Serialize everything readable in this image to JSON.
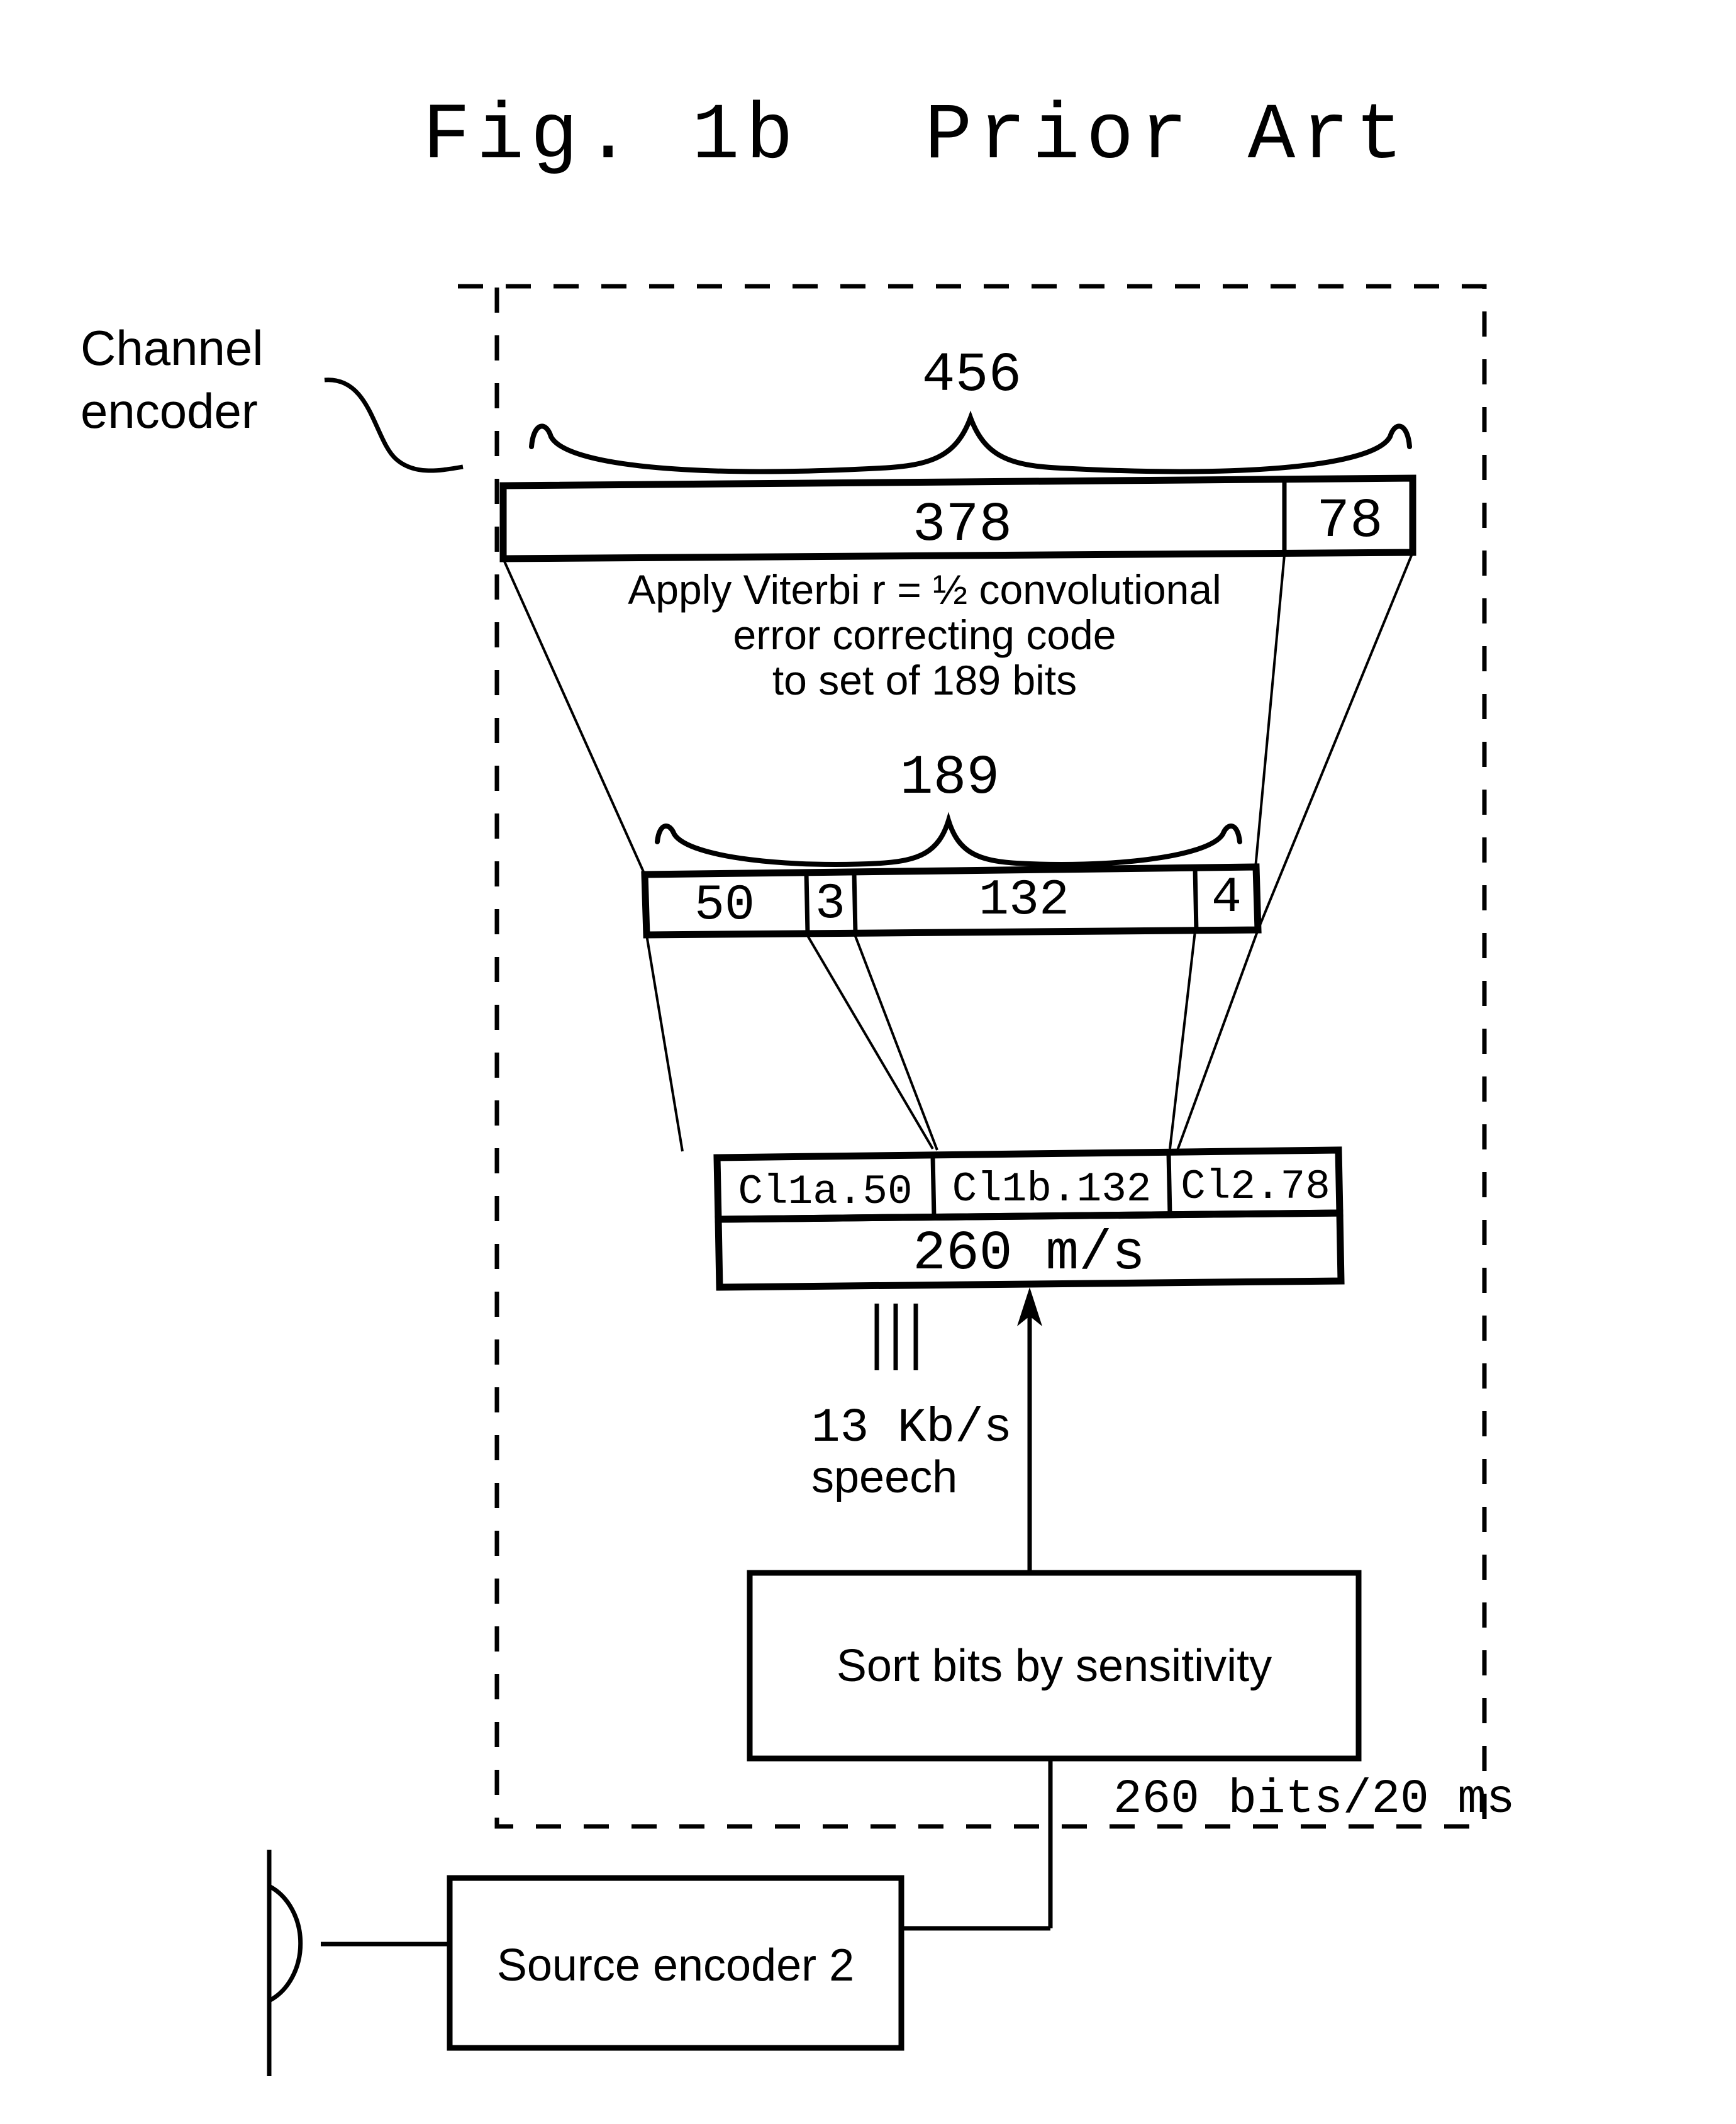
{
  "figure": {
    "title_label": "Fig. 1b",
    "title_note": "Prior Art",
    "channel_encoder_label_line1": "Channel",
    "channel_encoder_label_line2": "encoder"
  },
  "top_block": {
    "brace_label": "456",
    "segments": [
      {
        "label": "378"
      },
      {
        "label": "78"
      }
    ]
  },
  "viterbi_block": {
    "line1": "Apply Viterbi r = ½ convolutional",
    "line2": "error correcting code",
    "line3": "to set of 189 bits"
  },
  "mid_block": {
    "brace_label": "189",
    "segments": [
      {
        "label": "50"
      },
      {
        "label": "3"
      },
      {
        "label": "132"
      },
      {
        "label": "4"
      }
    ]
  },
  "class_block": {
    "segments": [
      {
        "label": "Cl1a.50"
      },
      {
        "label": "Cl1b.132"
      },
      {
        "label": "Cl2.78"
      }
    ],
    "rate_label": "260 m/s"
  },
  "speech_annotation": {
    "rate": "13 Kb/s",
    "kind": "speech"
  },
  "sort_box": {
    "label": "Sort bits by sensitivity"
  },
  "boundary_annotation": {
    "label": "260 bits/20 ms"
  },
  "source_encoder_box": {
    "label": "Source encoder 2"
  },
  "colors": {
    "ink": "#000000",
    "paper": "#ffffff"
  }
}
